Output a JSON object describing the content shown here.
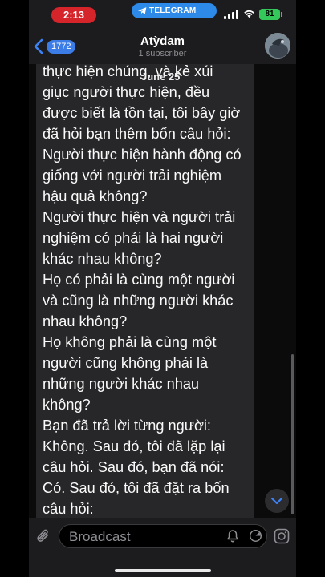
{
  "status_bar": {
    "time": "2:13",
    "app_pill": "TELEGRAM",
    "battery": "81"
  },
  "header": {
    "back_count": "1772",
    "title": "Atỳdam",
    "subtitle": "1 subscriber"
  },
  "chat": {
    "date_chip": "June 25",
    "message_lines": [
      "thực hiện chúng, và kẻ xúi",
      "giục người thực hiện, đều",
      "được biết là tồn tại, tôi bây giờ",
      "đã hỏi bạn thêm bốn câu hỏi:",
      "Người thực hiện hành động có",
      "giống với người trải nghiệm",
      "hậu quả không?",
      "Người thực hiện và người trải",
      "nghiệm có phải là hai người",
      "khác nhau không?",
      "Họ có phải là cùng một người",
      "và cũng là những người khác",
      "nhau không?",
      "Họ không phải là cùng một",
      "người cũng không phải là",
      "những người khác nhau",
      "không?",
      "Bạn đã trả lời từng người:",
      "Không. Sau đó, tôi đã lặp lại",
      "câu hỏi. Sau đó, bạn đã nói:",
      "Có. Sau đó, tôi đã đặt ra bốn",
      "câu hỏi:"
    ]
  },
  "input_bar": {
    "placeholder": "Broadcast"
  },
  "icons": {
    "attach": "paperclip-icon",
    "bell": "bell-icon",
    "timer": "timer-icon",
    "instagram": "instagram-icon",
    "scroll_down": "chevron-down-icon"
  },
  "colors": {
    "telegram_blue": "#2d8ae8",
    "recording_red": "#d5252b",
    "battery_green": "#34c759",
    "accent_blue": "#3b7ce6"
  }
}
